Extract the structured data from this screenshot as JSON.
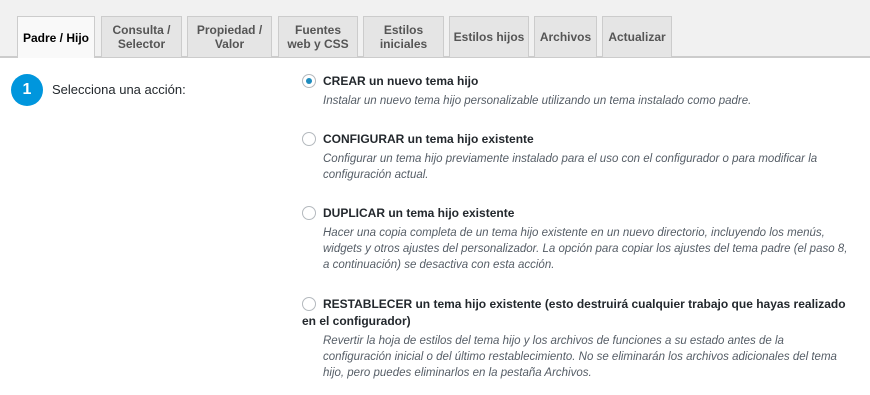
{
  "tabs": [
    {
      "label": "Padre / Hijo",
      "active": true
    },
    {
      "label": "Consulta /\nSelector",
      "active": false
    },
    {
      "label": "Propiedad /\nValor",
      "active": false
    },
    {
      "label": "Fuentes\nweb y CSS",
      "active": false
    },
    {
      "label": "Estilos\niniciales",
      "active": false
    },
    {
      "label": "Estilos hijos",
      "active": false
    },
    {
      "label": "Archivos",
      "active": false
    },
    {
      "label": "Actualizar",
      "active": false
    }
  ],
  "step": {
    "number": "1",
    "label": "Selecciona una acción:"
  },
  "options": [
    {
      "title": "CREAR un nuevo tema hijo",
      "description": "Instalar un nuevo tema hijo personalizable utilizando un tema instalado como padre.",
      "checked": true
    },
    {
      "title": "CONFIGURAR un tema hijo existente",
      "description": "Configurar un tema hijo previamente instalado para el uso con el configurador o para modificar la configuración actual.",
      "checked": false
    },
    {
      "title": "DUPLICAR un tema hijo existente",
      "description": "Hacer una copia completa de un tema hijo existente en un nuevo directorio, incluyendo los menús, widgets y otros ajustes del personalizador. La opción para copiar los ajustes del tema padre (el paso 8, a continuación) se desactiva con esta acción.",
      "checked": false
    },
    {
      "title": "RESTABLECER un tema hijo existente (esto destruirá cualquier trabajo que hayas realizado en el configurador)",
      "description": "Revertir la hoja de estilos del tema hijo y los archivos de funciones a su estado antes de la configuración inicial o del último restablecimiento. No se eliminarán los archivos adicionales del tema hijo, pero puedes eliminarlos en la pestaña Archivos.",
      "checked": false
    }
  ],
  "colors": {
    "accent": "#0096dd",
    "radio_dot": "#1e8cbe",
    "tab_bg": "#e5e5e5",
    "tab_active_bg": "#f9f9f9",
    "page_bg": "#f1f1f1"
  }
}
